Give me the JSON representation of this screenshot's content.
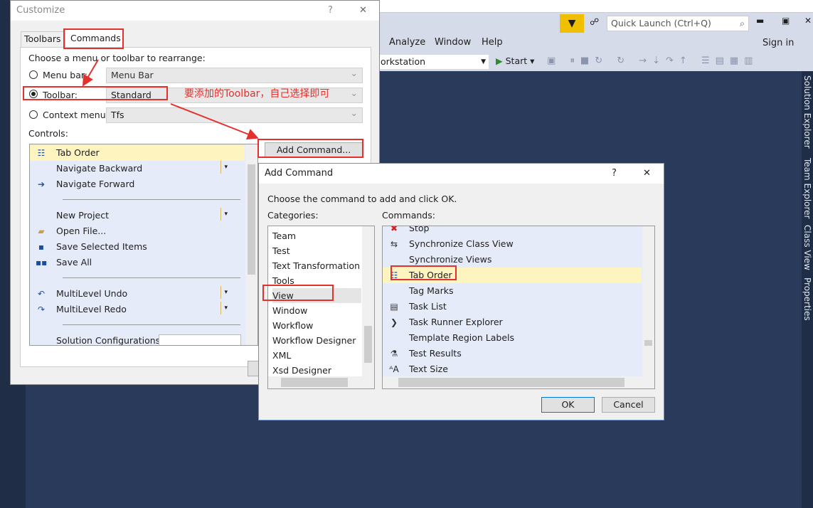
{
  "vs": {
    "quick_launch_placeholder": "Quick Launch (Ctrl+Q)",
    "menus": [
      "Analyze",
      "Window",
      "Help"
    ],
    "sign_in": "Sign in",
    "config_combo": "orkstation",
    "start": "Start",
    "side_tabs": [
      "Solution Explorer",
      "Team Explorer",
      "Class View",
      "Properties"
    ],
    "accent": "#f0c000"
  },
  "customize": {
    "title": "Customize",
    "help": "?",
    "close": "✕",
    "tabs": [
      "Toolbars",
      "Commands"
    ],
    "choose_label": "Choose a menu or toolbar to rearrange:",
    "options": [
      {
        "label": "Menu bar:",
        "value": "Menu Bar",
        "selected": false
      },
      {
        "label": "Toolbar:",
        "value": "Standard",
        "selected": true
      },
      {
        "label": "Context menu:",
        "value": "Tfs",
        "selected": false
      }
    ],
    "annotation": "要添加的Toolbar，自己选择即可",
    "controls_label": "Controls:",
    "add_command": "Add Command...",
    "controls": [
      {
        "icon": "tab-order",
        "label": "Tab Order"
      },
      {
        "icon": "",
        "label": "Navigate Backward"
      },
      {
        "icon": "navigate-forward",
        "label": "Navigate Forward"
      },
      {
        "icon": "",
        "label": "New Project"
      },
      {
        "icon": "open-file",
        "label": "Open File..."
      },
      {
        "icon": "save",
        "label": "Save Selected Items"
      },
      {
        "icon": "save-all",
        "label": "Save All"
      },
      {
        "icon": "undo",
        "label": "MultiLevel Undo"
      },
      {
        "icon": "redo",
        "label": "MultiLevel Redo"
      },
      {
        "icon": "",
        "label": "Solution Configurations"
      }
    ]
  },
  "add_command": {
    "title": "Add Command",
    "help": "?",
    "close": "✕",
    "instruction": "Choose the command to add and click OK.",
    "categories_label": "Categories:",
    "commands_label": "Commands:",
    "categories": [
      "Team",
      "Test",
      "Text Transformation",
      "Tools",
      "View",
      "Window",
      "Workflow",
      "Workflow Designer",
      "XML",
      "Xsd Designer"
    ],
    "selected_category": "View",
    "commands": [
      {
        "icon": "stop",
        "label": "Stop"
      },
      {
        "icon": "sync-class-view",
        "label": "Synchronize Class View"
      },
      {
        "icon": "",
        "label": "Synchronize Views"
      },
      {
        "icon": "tab-order",
        "label": "Tab Order"
      },
      {
        "icon": "",
        "label": "Tag Marks"
      },
      {
        "icon": "task-list",
        "label": "Task List"
      },
      {
        "icon": "task-runner",
        "label": "Task Runner Explorer"
      },
      {
        "icon": "",
        "label": "Template Region Labels"
      },
      {
        "icon": "test-results",
        "label": "Test Results"
      },
      {
        "icon": "text-size",
        "label": "Text Size"
      }
    ],
    "selected_command": "Tab Order",
    "ok": "OK",
    "cancel": "Cancel"
  }
}
